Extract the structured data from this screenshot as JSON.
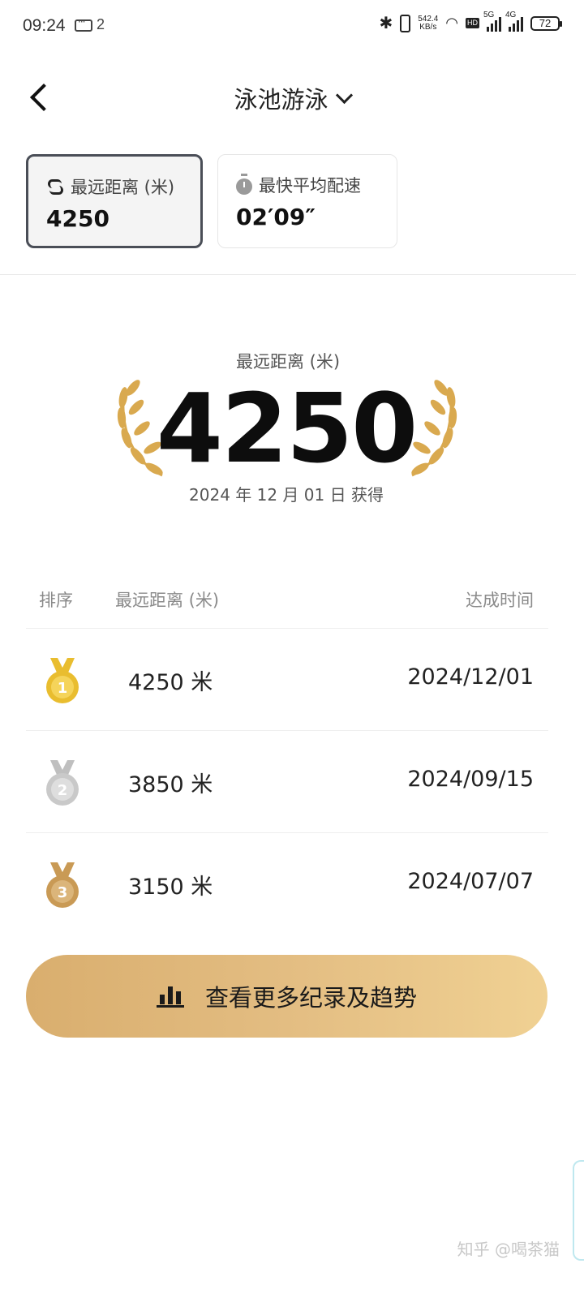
{
  "status_bar": {
    "time": "09:24",
    "notif_count": "2",
    "net_speed": "542.4",
    "net_unit": "KB/s",
    "signal1": "5G",
    "signal2": "4G",
    "battery": "72"
  },
  "header": {
    "title": "泳池游泳"
  },
  "cards": [
    {
      "label": "最远距离 (米)",
      "value": "4250",
      "icon": "route-icon",
      "selected": true
    },
    {
      "label": "最快平均配速",
      "value": "02′09″",
      "icon": "timer-icon",
      "selected": false
    }
  ],
  "hero": {
    "label": "最远距离 (米)",
    "value": "4250",
    "date": "2024 年 12 月 01 日 获得"
  },
  "table": {
    "headers": {
      "rank": "排序",
      "distance": "最远距离 (米)",
      "time": "达成时间"
    },
    "rows": [
      {
        "rank": "1",
        "distance": "4250 米",
        "date": "2024/12/01",
        "medal": "gold"
      },
      {
        "rank": "2",
        "distance": "3850 米",
        "date": "2024/09/15",
        "medal": "silver"
      },
      {
        "rank": "3",
        "distance": "3150 米",
        "date": "2024/07/07",
        "medal": "bronze"
      }
    ]
  },
  "more_button": {
    "label": "查看更多纪录及趋势"
  },
  "watermark": "知乎 @喝茶猫",
  "colors": {
    "gold": "#e9bd2f",
    "silver": "#c9c9c9",
    "bronze": "#c99a55",
    "button_start": "#d9ae6e",
    "button_end": "#f0d193",
    "laurel": "#d9a94f"
  }
}
